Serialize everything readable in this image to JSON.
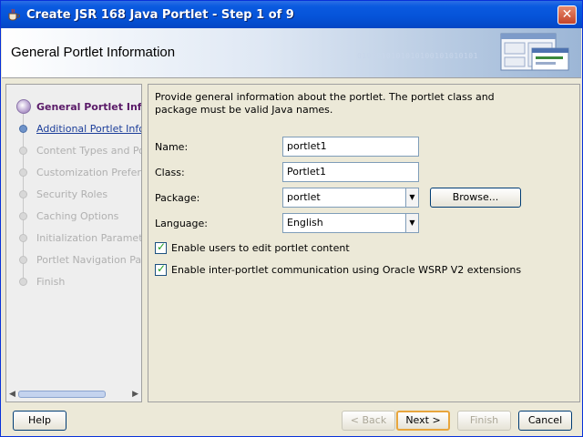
{
  "window": {
    "title": "Create JSR 168 Java Portlet - Step 1 of 9",
    "close_glyph": "✕"
  },
  "banner": {
    "title": "General Portlet Information",
    "watermark": "0101010101010100101010101"
  },
  "nav": {
    "items": [
      {
        "label": "General Portlet Information",
        "state": "active"
      },
      {
        "label": "Additional Portlet Information",
        "state": "next"
      },
      {
        "label": "Content Types and Portlet Modes",
        "state": "disabled"
      },
      {
        "label": "Customization Preferences",
        "state": "disabled"
      },
      {
        "label": "Security Roles",
        "state": "disabled"
      },
      {
        "label": "Caching Options",
        "state": "disabled"
      },
      {
        "label": "Initialization Parameters",
        "state": "disabled"
      },
      {
        "label": "Portlet Navigation Parameters",
        "state": "disabled"
      },
      {
        "label": "Finish",
        "state": "disabled"
      }
    ]
  },
  "content": {
    "intro": "Provide general information about the portlet. The portlet class and package must be valid Java names.",
    "name": {
      "label": "Name:",
      "value": "portlet1"
    },
    "class": {
      "label": "Class:",
      "value": "Portlet1"
    },
    "package": {
      "label": "Package:",
      "value": "portlet",
      "browse_label": "Browse..."
    },
    "language": {
      "label": "Language:",
      "value": "English"
    },
    "checkbox_edit": {
      "label": "Enable users to edit portlet content",
      "checked": true
    },
    "checkbox_wsrp": {
      "label": "Enable inter-portlet communication using Oracle WSRP V2 extensions",
      "checked": true
    }
  },
  "footer": {
    "help": "Help",
    "back": "< Back",
    "next": "Next >",
    "finish": "Finish",
    "cancel": "Cancel"
  }
}
